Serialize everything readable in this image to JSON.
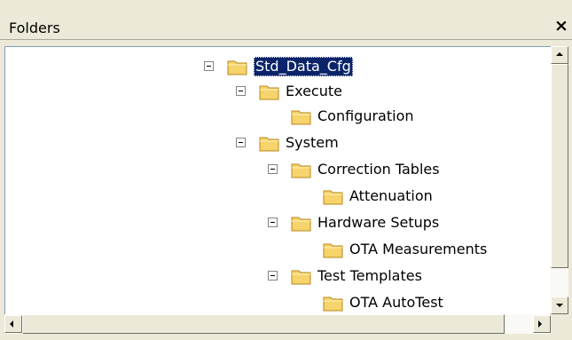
{
  "pane": {
    "title": "Folders",
    "close_glyph": "×"
  },
  "tree": {
    "nodes": [
      {
        "label": "Std_Data_Cfg",
        "expanded": true,
        "selected": true
      },
      {
        "label": "Execute",
        "expanded": true
      },
      {
        "label": "Configuration"
      },
      {
        "label": "System",
        "expanded": true
      },
      {
        "label": "Correction Tables",
        "expanded": true
      },
      {
        "label": "Attenuation"
      },
      {
        "label": "Hardware Setups",
        "expanded": true
      },
      {
        "label": "OTA Measurements"
      },
      {
        "label": "Test Templates",
        "expanded": true
      },
      {
        "label": "OTA AutoTest"
      }
    ]
  },
  "icons": {
    "folder": "folder-icon",
    "collapse": "minus-box-icon",
    "close": "close-icon"
  },
  "colors": {
    "selection": "#0a246a",
    "folder_fill": "#f6d36b",
    "folder_edge": "#b58a1e"
  }
}
